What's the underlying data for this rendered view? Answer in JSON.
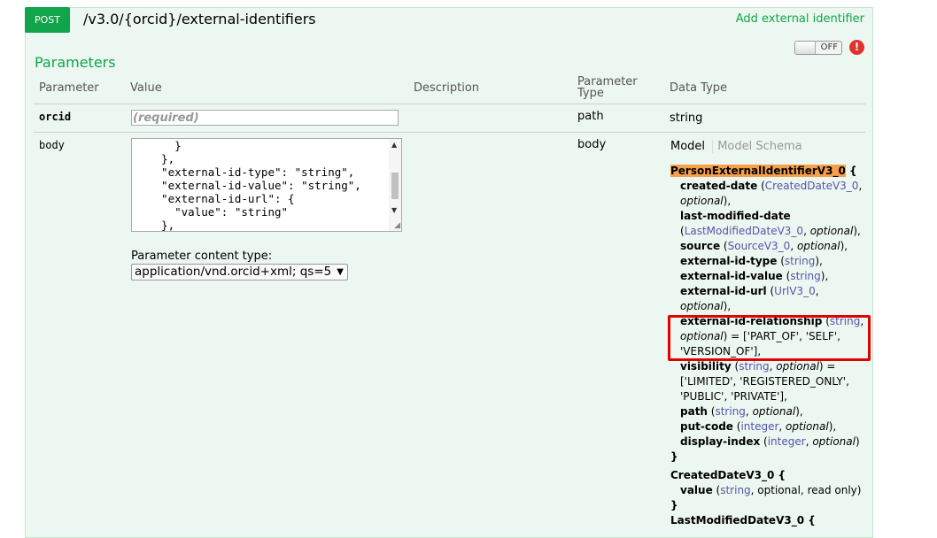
{
  "endpoint": {
    "method": "POST",
    "path": "/v3.0/{orcid}/external-identifiers",
    "summary": "Add external identifier"
  },
  "auth_toggle": {
    "label": "OFF",
    "alert": "!"
  },
  "parameters": {
    "title": "Parameters",
    "headers": {
      "parameter": "Parameter",
      "value": "Value",
      "description": "Description",
      "param_type_1": "Parameter",
      "param_type_2": "Type",
      "data_type": "Data Type"
    },
    "rows": [
      {
        "name": "orcid",
        "placeholder": "(required)",
        "param_type": "path",
        "data_type": "string"
      },
      {
        "name": "body",
        "param_type": "body"
      }
    ],
    "body_text": "    }\n  },\n  \"external-id-type\": \"string\",\n  \"external-id-value\": \"string\",\n  \"external-id-url\": {\n    \"value\": \"string\"\n  },\n  \"external-id-relationship\": \"",
    "content_type_label": "Parameter content type:",
    "content_type_value": "application/vnd.orcid+xml; qs=5"
  },
  "model_tabs": {
    "model": "Model",
    "schema": "Model Schema"
  },
  "model": {
    "name": "PersonExternalIdentifierV3_0",
    "open_brace": " {",
    "close_brace": "}",
    "next_model": "CreatedDateV3_0 {",
    "next_model_field": "value",
    "next_model_type": "string",
    "next_model_opts": ", optional, read only)",
    "next_model_close": "}",
    "cut_off": "LastModifiedDateV3_0 {"
  },
  "colors": {
    "accent": "#10a54a",
    "panel_bg": "#ebf7f0",
    "highlight_border": "#e00000",
    "model_name_bg": "#f7a04a",
    "type_link": "#5555aa"
  }
}
